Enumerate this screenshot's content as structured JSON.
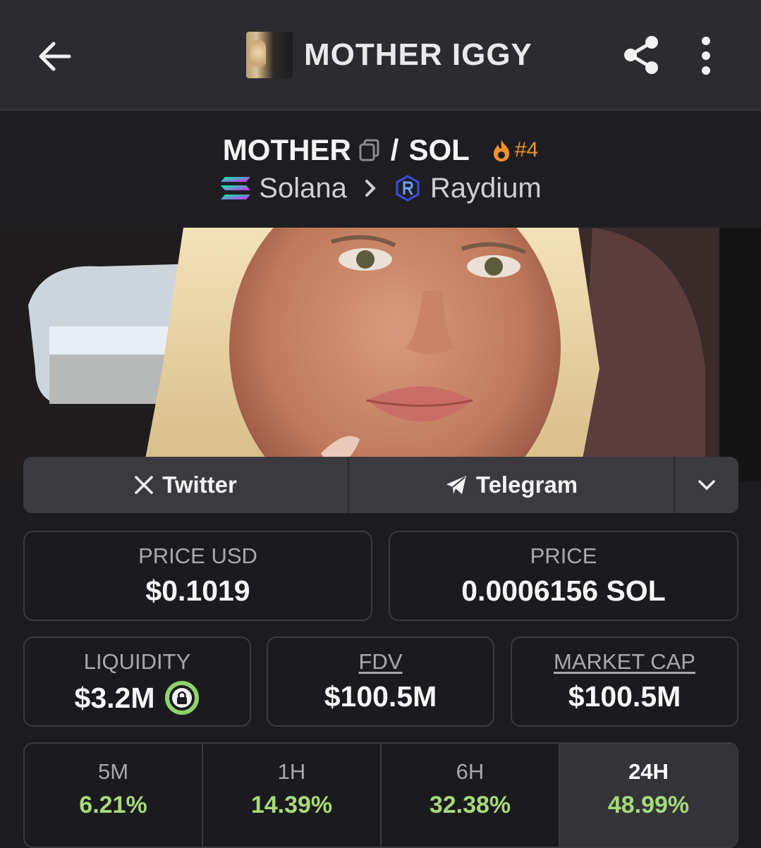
{
  "header": {
    "title": "MOTHER IGGY"
  },
  "pair": {
    "base": "MOTHER",
    "separator": "/",
    "quote": "SOL",
    "rank": "#4",
    "chain": "Solana",
    "dex": "Raydium"
  },
  "social": {
    "twitter_label": "Twitter",
    "telegram_label": "Telegram"
  },
  "stats": {
    "price_usd": {
      "label": "PRICE USD",
      "value": "$0.1019"
    },
    "price_native": {
      "label": "PRICE",
      "value": "0.0006156 SOL"
    },
    "liquidity": {
      "label": "LIQUIDITY",
      "value": "$3.2M"
    },
    "fdv": {
      "label": "FDV",
      "value": "$100.5M"
    },
    "market_cap": {
      "label": "MARKET CAP",
      "value": "$100.5M"
    }
  },
  "timeframes": [
    {
      "label": "5M",
      "change": "6.21%"
    },
    {
      "label": "1H",
      "change": "14.39%"
    },
    {
      "label": "6H",
      "change": "32.38%"
    },
    {
      "label": "24H",
      "change": "48.99%",
      "active": true
    }
  ],
  "colors": {
    "positive": "#a6da7a",
    "rank": "#f0922b",
    "liquidity_lock": "#8fd46a"
  },
  "icons": [
    "back-arrow-icon",
    "share-icon",
    "more-vert-icon",
    "copy-icon",
    "fire-icon",
    "solana-icon",
    "chevron-right-icon",
    "raydium-icon",
    "x-logo-icon",
    "telegram-icon",
    "chevron-down-icon",
    "lock-icon"
  ]
}
